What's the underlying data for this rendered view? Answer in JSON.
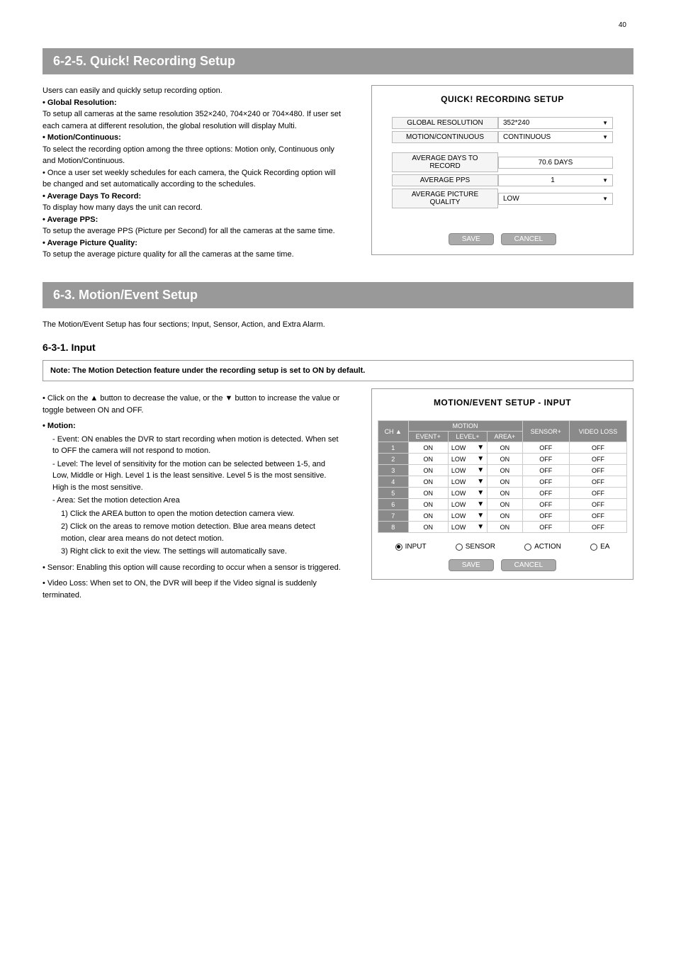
{
  "page_number": "40",
  "section1": {
    "title": "6-2-5. Quick! Recording Setup",
    "para1": "Users can easily and quickly setup recording option.",
    "bullet1": "• Global Resolution:",
    "bullet1_body": "To setup all cameras at the same resolution 352×240, 704×240 or 704×480. If user set each camera at different resolution, the global resolution will display Multi.",
    "bullet2": "• Motion/Continuous:",
    "bullet2_body": "To select the recording option among the three options: Motion only, Continuous only and Motion/Continuous.",
    "bullet3": "•",
    "bullet3_body": "Once a user set weekly schedules for each camera, the Quick Recording option will be changed and set automatically according to the schedules.",
    "bullet4": "• Average Days To Record:",
    "bullet4_body": "To display how many days the unit can record.",
    "bullet5": "• Average PPS:",
    "bullet5_body": "To setup the average PPS (Picture per Second) for all the cameras at the same time.",
    "bullet6": "• Average Picture Quality:",
    "bullet6_body": "To setup the average picture quality for all the cameras at the same time."
  },
  "panel1": {
    "title": "QUICK! RECORDING SETUP",
    "rows": [
      {
        "label": "GLOBAL RESOLUTION",
        "value": "352*240",
        "drop": true,
        "center": false
      },
      {
        "label": "MOTION/CONTINUOUS",
        "value": "CONTINUOUS",
        "drop": true,
        "center": false
      }
    ],
    "rows2": [
      {
        "label": "AVERAGE DAYS TO RECORD",
        "value": "70.6 DAYS",
        "drop": false,
        "center": true
      },
      {
        "label": "AVERAGE PPS",
        "value": "1",
        "drop": true,
        "center": true
      },
      {
        "label": "AVERAGE PICTURE QUALITY",
        "value": "LOW",
        "drop": true,
        "center": false
      }
    ],
    "save": "SAVE",
    "cancel": "CANCEL"
  },
  "section2": {
    "title": "6-3. Motion/Event Setup",
    "lead": "The Motion/Event Setup has four sections; Input, Sensor, Action, and Extra Alarm.",
    "sub": "6-3-1. Input",
    "note": "Note: The Motion Detection feature under the recording setup is set to ON by default.",
    "intro": "• Click on the ▲ button to decrease the value, or the ▼ button to increase the value or toggle between ON and OFF.",
    "b_motion": "• Motion:",
    "b_event": "- Event: ON enables the DVR to start recording when motion is detected. When set to OFF the camera will not respond to motion.",
    "b_level": "- Level: The level of sensitivity for the motion can be selected between 1-5, and Low, Middle or High. Level 1 is the least sensitive. Level 5 is the most sensitive. High is the most sensitive.",
    "b_area_intro": "- Area: Set the motion detection Area",
    "b_area1": "1) Click the AREA button to open the motion detection camera view.",
    "b_area2": "2) Click on the areas to remove motion detection. Blue area means detect motion, clear area means do not detect motion.",
    "b_area3": "3) Right click to exit the view. The settings will automatically save.",
    "b_sensor": "• Sensor: Enabling this option will cause recording to occur when a sensor is triggered.",
    "b_videoloss": "• Video Loss: When set to ON, the DVR will beep if the Video signal is suddenly terminated."
  },
  "panel2": {
    "title": "MOTION/EVENT SETUP - INPUT",
    "head": {
      "ch": "CH ▲",
      "motion": "MOTION",
      "event": "EVENT+",
      "level": "LEVEL+",
      "area": "AREA+",
      "sensor": "SENSOR+",
      "vloss": "VIDEO LOSS"
    },
    "cols_level_drop": "▼",
    "rows": [
      {
        "ch": "1",
        "event": "ON",
        "level": "LOW",
        "area": "ON",
        "sensor": "OFF",
        "vloss": "OFF"
      },
      {
        "ch": "2",
        "event": "ON",
        "level": "LOW",
        "area": "ON",
        "sensor": "OFF",
        "vloss": "OFF"
      },
      {
        "ch": "3",
        "event": "ON",
        "level": "LOW",
        "area": "ON",
        "sensor": "OFF",
        "vloss": "OFF"
      },
      {
        "ch": "4",
        "event": "ON",
        "level": "LOW",
        "area": "ON",
        "sensor": "OFF",
        "vloss": "OFF"
      },
      {
        "ch": "5",
        "event": "ON",
        "level": "LOW",
        "area": "ON",
        "sensor": "OFF",
        "vloss": "OFF"
      },
      {
        "ch": "6",
        "event": "ON",
        "level": "LOW",
        "area": "ON",
        "sensor": "OFF",
        "vloss": "OFF"
      },
      {
        "ch": "7",
        "event": "ON",
        "level": "LOW",
        "area": "ON",
        "sensor": "OFF",
        "vloss": "OFF"
      },
      {
        "ch": "8",
        "event": "ON",
        "level": "LOW",
        "area": "ON",
        "sensor": "OFF",
        "vloss": "OFF"
      }
    ],
    "radios": {
      "input": "INPUT",
      "sensor": "SENSOR",
      "action": "ACTION",
      "ea": "EA",
      "selected": "input"
    },
    "save": "SAVE",
    "cancel": "CANCEL"
  }
}
